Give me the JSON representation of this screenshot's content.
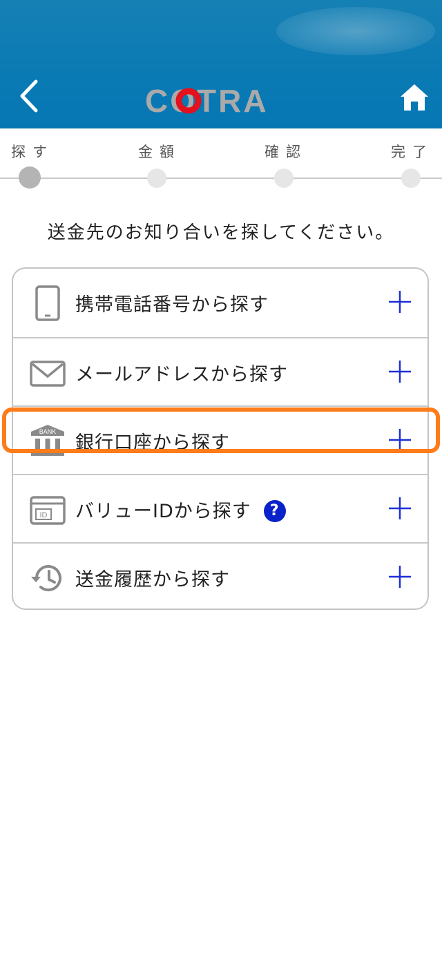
{
  "header": {
    "logo_text": "COTRA",
    "back_icon": "chevron-left-icon",
    "home_icon": "home-icon",
    "colors": {
      "bar": "#0a7ab4",
      "logo_gray": "#aaaaaa",
      "logo_red": "#e3101d"
    }
  },
  "steps": [
    {
      "label": "探す",
      "active": true
    },
    {
      "label": "金額",
      "active": false
    },
    {
      "label": "確認",
      "active": false
    },
    {
      "label": "完了",
      "active": false
    }
  ],
  "instruction": "送金先のお知り合いを探してください。",
  "options": [
    {
      "icon": "smartphone-icon",
      "label": "携帯電話番号から探す"
    },
    {
      "icon": "mail-icon",
      "label": "メールアドレスから探す"
    },
    {
      "icon": "bank-icon",
      "label": "銀行口座から探す",
      "bank_text": "BANK"
    },
    {
      "icon": "id-card-icon",
      "label": "バリューIDから探す",
      "id_text": "ID",
      "help": "?"
    },
    {
      "icon": "history-icon",
      "label": "送金履歴から探す"
    }
  ],
  "accent": {
    "plus": "#1c2fd6",
    "highlight": "#ff7c1a"
  }
}
